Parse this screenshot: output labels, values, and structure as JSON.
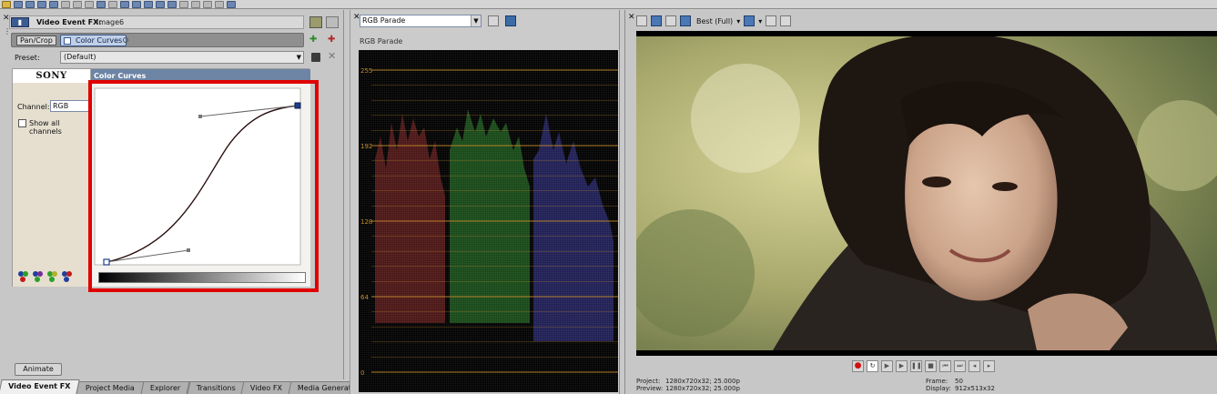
{
  "left_panel": {
    "title": "Video Event FX:",
    "event_name": "Image6",
    "chain": {
      "pan_crop_label": "Pan/Crop",
      "color_curves_label": "Color Curves"
    },
    "preset": {
      "label": "Preset:",
      "value": "(Default)"
    },
    "plugin": {
      "brand": "SONY",
      "title": "Color Curves",
      "channel_label": "Channel:",
      "channel_value": "RGB",
      "show_all_label": "Show all channels",
      "show_all_checked": false
    },
    "animate_label": "Animate",
    "tabs": [
      "Video Event FX",
      "Project Media",
      "Explorer",
      "Transitions",
      "Video FX",
      "Media Generators"
    ]
  },
  "scope_panel": {
    "selected_scope": "RGB Parade",
    "scope_title": "RGB Parade",
    "y_labels": [
      "255",
      "192",
      "128",
      "64",
      "0"
    ]
  },
  "preview_panel": {
    "quality": "Best (Full)",
    "status": {
      "project_label": "Project:",
      "project_value": "1280x720x32; 25.000p",
      "preview_label": "Preview:",
      "preview_value": "1280x720x32; 25.000p",
      "frame_label": "Frame:",
      "frame_value": "50",
      "display_label": "Display:",
      "display_value": "912x513x32"
    }
  },
  "colors": {
    "highlight": "#e00000",
    "scope_line": "#c48a2a",
    "plugin_title_bar": "#6d84a5"
  }
}
